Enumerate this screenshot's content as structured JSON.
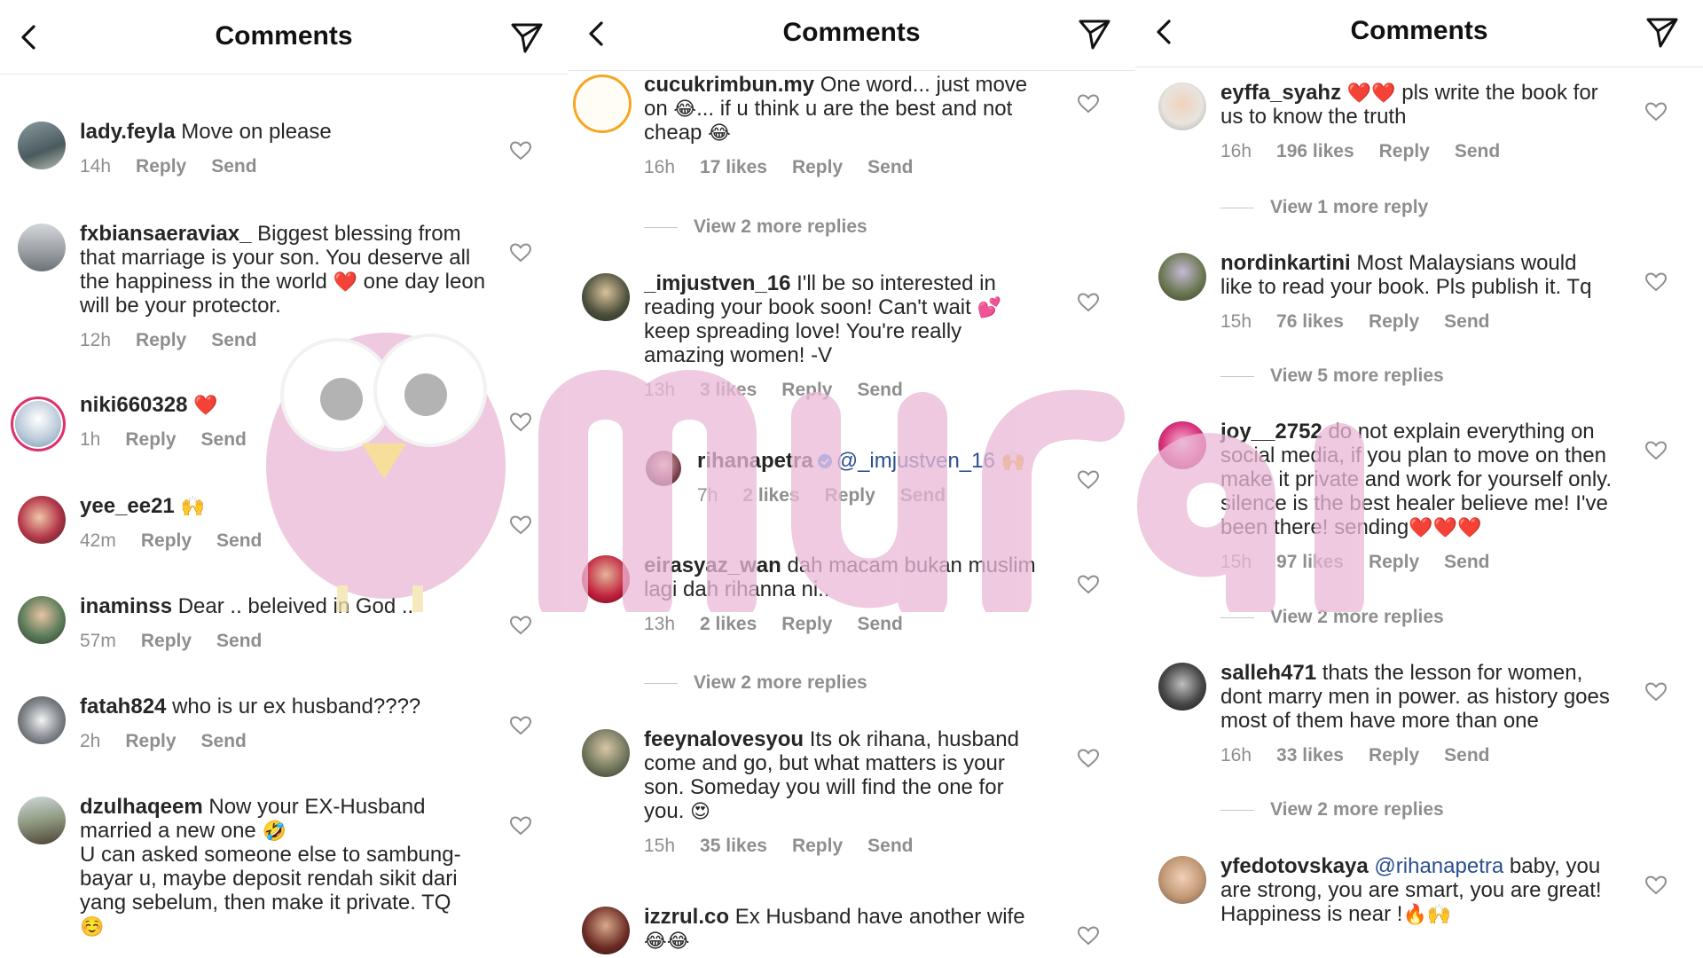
{
  "header": {
    "title": "Comments"
  },
  "panel1": {
    "comments": [
      {
        "user": "lady.feyla",
        "text": "Move on please",
        "time": "14h",
        "likes": "",
        "reply": "Reply",
        "send": "Send"
      },
      {
        "user": "fxbiansaeraviax_",
        "text": "Biggest blessing from that marriage is your son. You deserve all the happiness in the world",
        "emoji": "❤️",
        "text2": "one day leon will be your protector.",
        "time": "12h",
        "reply": "Reply",
        "send": "Send"
      },
      {
        "user": "niki660328",
        "emoji": "❤️",
        "time": "1h",
        "reply": "Reply",
        "send": "Send"
      },
      {
        "user": "yee_ee21",
        "emoji": "🙌",
        "time": "42m",
        "reply": "Reply",
        "send": "Send"
      },
      {
        "user": "inaminss",
        "text": "Dear .. beleived in God ..",
        "time": "57m",
        "reply": "Reply",
        "send": "Send"
      },
      {
        "user": "fatah824",
        "text": "who is ur ex husband????",
        "time": "2h",
        "reply": "Reply",
        "send": "Send"
      },
      {
        "user": "dzulhaqeem",
        "text": "Now your EX-Husband married a new one",
        "emoji": "🤣",
        "text2": "U can asked someone else to sambung-bayar u, maybe deposit rendah sikit dari yang sebelum, then make it private. TQ",
        "emoji2": "☺️"
      }
    ]
  },
  "panel2": {
    "comments": [
      {
        "user": "cucukrimbun.my",
        "text": "One word... just move on",
        "emoji": "😂",
        "text2": "... if u think u are the best and not cheap",
        "emoji2": "😂",
        "time": "16h",
        "likes": "17 likes",
        "reply": "Reply",
        "send": "Send"
      },
      {
        "user": "_imjustven_16",
        "text": "I'll be so interested in reading your book soon! Can't wait",
        "emoji": "💕",
        "text2": "keep spreading love! You're really amazing women! -V",
        "time": "13h",
        "likes": "3 likes",
        "reply": "Reply",
        "send": "Send"
      },
      {
        "user": "rihanapetra",
        "mention": "@_imjustven_16",
        "emoji": "🙌",
        "time": "7h",
        "likes": "2 likes",
        "reply": "Reply",
        "send": "Send"
      },
      {
        "user": "eirasyaz_wan",
        "text": "dah macam bukan muslim lagi dah rihanna ni..",
        "time": "13h",
        "likes": "2 likes",
        "reply": "Reply",
        "send": "Send"
      },
      {
        "user": "feeynalovesyou",
        "text": "Its ok rihana, husband come and go, but what matters is your son. Someday you will find the one for you.",
        "emoji": "😍",
        "time": "15h",
        "likes": "35 likes",
        "reply": "Reply",
        "send": "Send"
      },
      {
        "user": "izzrul.co",
        "text": "Ex Husband have another wife",
        "emoji": "😂😂"
      }
    ],
    "view_more_1": "View 2 more replies",
    "view_more_2": "View 2 more replies"
  },
  "panel3": {
    "comments": [
      {
        "user": "eyffa_syahz",
        "emoji": "❤️❤️",
        "text": "pls write the book for us to know the truth",
        "time": "16h",
        "likes": "196 likes",
        "reply": "Reply",
        "send": "Send"
      },
      {
        "user": "nordinkartini",
        "text": "Most Malaysians would like to read your book. Pls publish it. Tq",
        "time": "15h",
        "likes": "76 likes",
        "reply": "Reply",
        "send": "Send"
      },
      {
        "user": "joy__2752",
        "text": "do not explain everything on social media, if you plan to move on then make it private and work for yourself only. silence is the best healer believe me! I've been there! sending",
        "emoji": "❤️❤️❤️",
        "time": "15h",
        "likes": "97 likes",
        "reply": "Reply",
        "send": "Send"
      },
      {
        "user": "salleh471",
        "text": "thats the lesson for women, dont marry men in power. as history goes most of them have more than one",
        "time": "16h",
        "likes": "33 likes",
        "reply": "Reply",
        "send": "Send"
      },
      {
        "user": "yfedotovskaya",
        "mention": "@rihanapetra",
        "text": "baby, you are strong, you are smart, you are great! Happiness is near !",
        "emoji": "🔥🙌"
      }
    ],
    "view_more_1": "View 1 more reply",
    "view_more_2": "View 5 more replies",
    "view_more_3": "View 2 more replies",
    "view_more_4": "View 2 more replies"
  },
  "colors": {
    "accent_heart": "#e0245e",
    "meta_gray": "#8e8e8e",
    "watermark_pink": "#e9b8d6"
  },
  "icons": [
    "back-icon",
    "send-icon",
    "heart-icon",
    "verified-icon"
  ]
}
